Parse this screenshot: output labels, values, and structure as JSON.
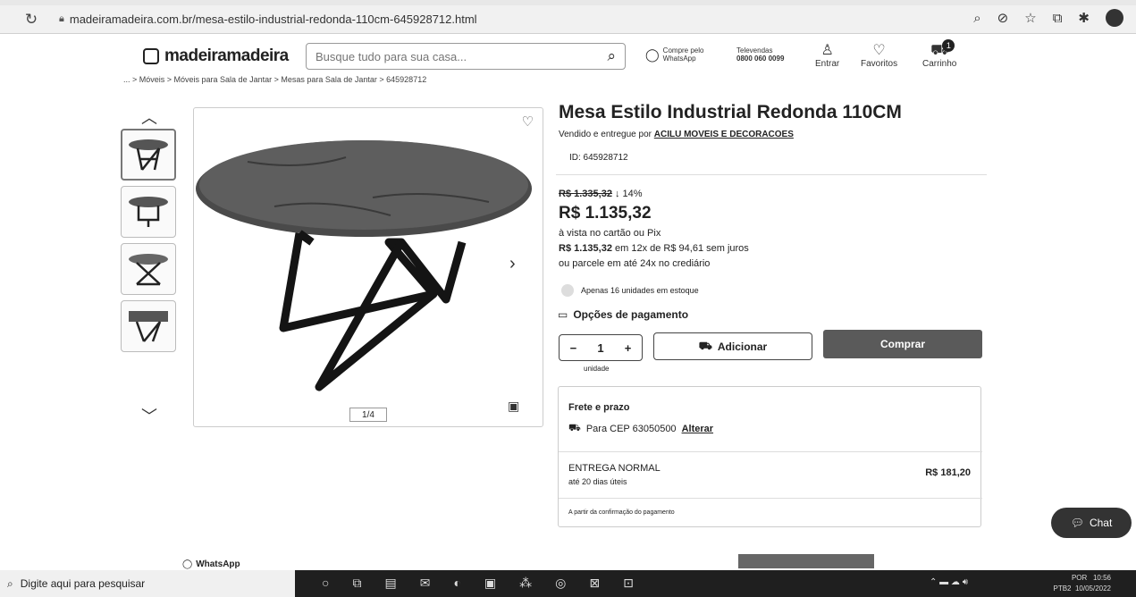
{
  "browser": {
    "url": "madeiramadeira.com.br/mesa-estilo-industrial-redonda-110cm-645928712.html",
    "reload_icon": "reload-icon"
  },
  "header": {
    "logo_text": "madeiramadeira",
    "search_placeholder": "Busque tudo para sua casa...",
    "whatsapp_line1": "Compre pelo",
    "whatsapp_line2": "WhatsApp",
    "televendas_line1": "Televendas",
    "televendas_line2": "0800 060 0099",
    "login": "Entrar",
    "favorites": "Favoritos",
    "cart": "Carrinho",
    "cart_count": "1"
  },
  "breadcrumb": "... > Móveis > Móveis para Sala de Jantar > Mesas para Sala de Jantar > 645928712",
  "gallery": {
    "counter": "1/4",
    "thumbnail_count": 4
  },
  "product": {
    "title": "Mesa Estilo Industrial Redonda 110CM",
    "seller_prefix": "Vendido e entregue por ",
    "seller": "ACILU MOVEIS E DECORACOES",
    "id": "ID: 645928712",
    "old_price": "R$ 1.335,32",
    "discount": "↓ 14%",
    "price": "R$ 1.135,32",
    "payment_line1": "à vista no cartão ou Pix",
    "installment_bold": "R$ 1.135,32",
    "installment_rest": " em 12x de R$ 94,61 sem juros",
    "payment_line3": "ou parcele em até 24x no crediário",
    "stock": "Apenas 16 unidades em estoque",
    "payment_options": "Opções de pagamento",
    "qty_minus": "−",
    "qty_value": "1",
    "qty_plus": "+",
    "qty_unit": "unidade",
    "add_button": "Adicionar",
    "buy_button": "Comprar"
  },
  "freight": {
    "title": "Frete e prazo",
    "cep_text": "Para CEP 63050500",
    "change": "Alterar",
    "shipping_name": "ENTREGA NORMAL",
    "shipping_time": "até 20 dias úteis",
    "shipping_price": "R$ 181,20",
    "note": "A partir da confirmação do pagamento"
  },
  "chat": {
    "label": "Chat"
  },
  "whatsapp_footer": "WhatsApp",
  "taskbar": {
    "search": "Digite aqui para pesquisar",
    "lang1": "POR",
    "lang2": "PTB2",
    "time": "10:56",
    "date": "10/05/2022"
  }
}
